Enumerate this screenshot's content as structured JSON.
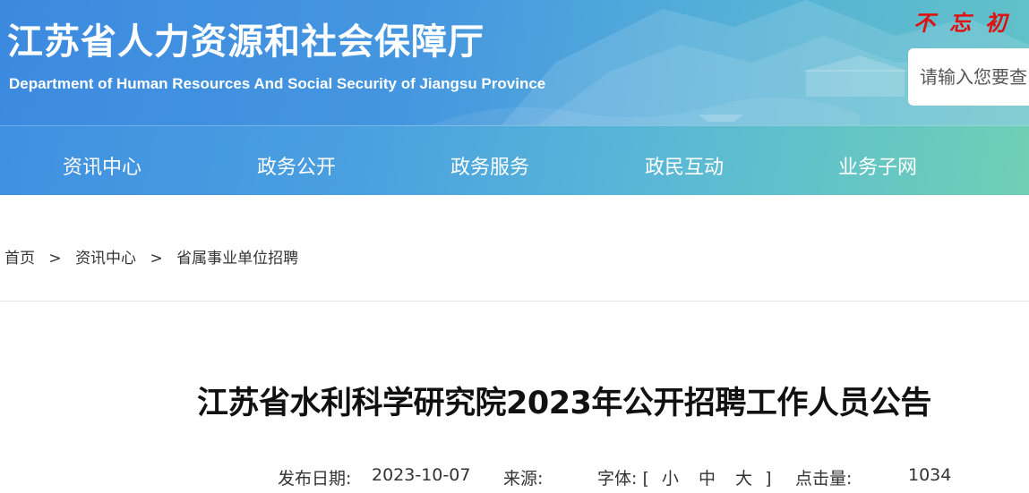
{
  "header": {
    "title": "江苏省人力资源和社会保障厅",
    "subtitle": "Department of Human Resources And Social Security of Jiangsu Province",
    "slogan": "不忘初",
    "search_placeholder": "请输入您要查"
  },
  "nav": {
    "items": [
      {
        "label": "资讯中心"
      },
      {
        "label": "政务公开"
      },
      {
        "label": "政务服务"
      },
      {
        "label": "政民互动"
      },
      {
        "label": "业务子网"
      }
    ]
  },
  "breadcrumb": {
    "items": [
      "首页",
      "资讯中心",
      "省属事业单位招聘"
    ],
    "separator": ">"
  },
  "article": {
    "title": "江苏省水利科学研究院2023年公开招聘工作人员公告",
    "publish_label": "发布日期:",
    "publish_date": "2023-10-07",
    "source_label": "来源:",
    "source_value": "",
    "font_label": "字体:",
    "font_open": "[",
    "font_small": "小",
    "font_medium": "中",
    "font_large": "大",
    "font_close": "]",
    "views_label": "点击量:",
    "views": "1034"
  },
  "colors": {
    "banner_start": "#3c8ae0",
    "banner_end": "#6fd0b5",
    "slogan": "#e01010",
    "text": "#333333"
  }
}
